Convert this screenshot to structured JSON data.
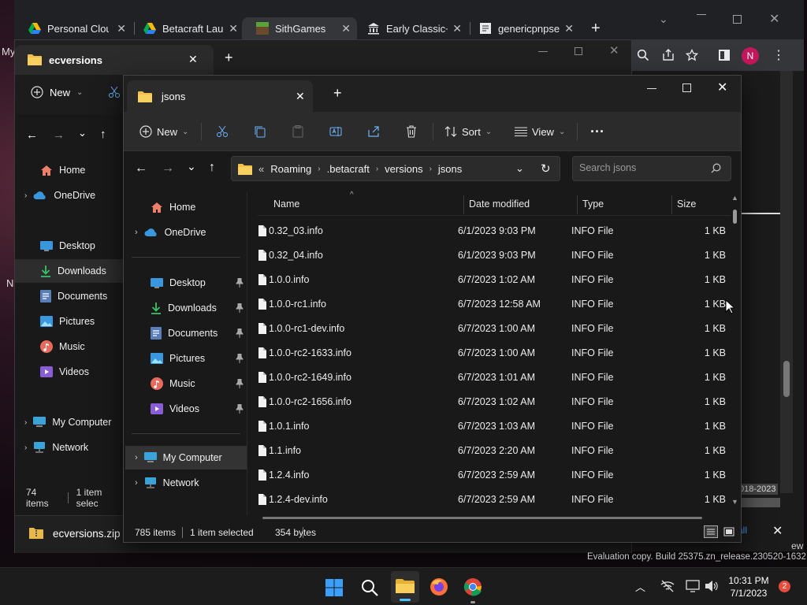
{
  "chrome": {
    "tabs": [
      {
        "title": "Personal Cloud",
        "icon": "drive-icon"
      },
      {
        "title": "Betacraft Launcher",
        "icon": "drive-icon"
      },
      {
        "title": "SithGames",
        "icon": "minecraft-icon"
      },
      {
        "title": "Early Classic+",
        "icon": "archive-icon"
      },
      {
        "title": "genericpnpservices",
        "icon": "page-icon"
      }
    ],
    "profile_initial": "N",
    "page_snippets": {
      "bottom_text": "018-2023",
      "side_text_my": "My",
      "side_text_n": "N",
      "side_text_ew": "ew",
      "link_all": "all"
    }
  },
  "back_explorer": {
    "tab_title": "ecversions",
    "new_label": "New",
    "sidebar": [
      {
        "label": "Home",
        "icon": "home-icon"
      },
      {
        "label": "OneDrive",
        "icon": "onedrive-icon"
      },
      {
        "label": "Desktop",
        "icon": "desktop-icon"
      },
      {
        "label": "Downloads",
        "icon": "downloads-icon"
      },
      {
        "label": "Documents",
        "icon": "documents-icon"
      },
      {
        "label": "Pictures",
        "icon": "pictures-icon"
      },
      {
        "label": "Music",
        "icon": "music-icon"
      },
      {
        "label": "Videos",
        "icon": "videos-icon"
      },
      {
        "label": "My Computer",
        "icon": "computer-icon"
      },
      {
        "label": "Network",
        "icon": "network-icon"
      }
    ],
    "status_items": "74 items",
    "status_selected": "1 item selec",
    "download_file": "ecversions.zip"
  },
  "front_explorer": {
    "tab_title": "jsons",
    "command_bar": {
      "new": "New",
      "sort": "Sort",
      "view": "View"
    },
    "address": {
      "prefix": "«",
      "crumbs": [
        "Roaming",
        ".betacraft",
        "versions",
        "jsons"
      ]
    },
    "search_placeholder": "Search jsons",
    "sidebar": [
      {
        "label": "Home",
        "icon": "home-icon"
      },
      {
        "label": "OneDrive",
        "icon": "onedrive-icon"
      },
      {
        "label": "Desktop",
        "icon": "desktop-icon"
      },
      {
        "label": "Downloads",
        "icon": "downloads-icon"
      },
      {
        "label": "Documents",
        "icon": "documents-icon"
      },
      {
        "label": "Pictures",
        "icon": "pictures-icon"
      },
      {
        "label": "Music",
        "icon": "music-icon"
      },
      {
        "label": "Videos",
        "icon": "videos-icon"
      },
      {
        "label": "My Computer",
        "icon": "computer-icon"
      },
      {
        "label": "Network",
        "icon": "network-icon"
      }
    ],
    "columns": [
      "Name",
      "Date modified",
      "Type",
      "Size"
    ],
    "files": [
      {
        "name": "0.32_03.info",
        "date": "6/1/2023 9:03 PM",
        "type": "INFO File",
        "size": "1 KB"
      },
      {
        "name": "0.32_04.info",
        "date": "6/1/2023 9:03 PM",
        "type": "INFO File",
        "size": "1 KB"
      },
      {
        "name": "1.0.0.info",
        "date": "6/7/2023 1:02 AM",
        "type": "INFO File",
        "size": "1 KB"
      },
      {
        "name": "1.0.0-rc1.info",
        "date": "6/7/2023 12:58 AM",
        "type": "INFO File",
        "size": "1 KB"
      },
      {
        "name": "1.0.0-rc1-dev.info",
        "date": "6/7/2023 1:00 AM",
        "type": "INFO File",
        "size": "1 KB"
      },
      {
        "name": "1.0.0-rc2-1633.info",
        "date": "6/7/2023 1:00 AM",
        "type": "INFO File",
        "size": "1 KB"
      },
      {
        "name": "1.0.0-rc2-1649.info",
        "date": "6/7/2023 1:01 AM",
        "type": "INFO File",
        "size": "1 KB"
      },
      {
        "name": "1.0.0-rc2-1656.info",
        "date": "6/7/2023 1:02 AM",
        "type": "INFO File",
        "size": "1 KB"
      },
      {
        "name": "1.0.1.info",
        "date": "6/7/2023 1:03 AM",
        "type": "INFO File",
        "size": "1 KB"
      },
      {
        "name": "1.1.info",
        "date": "6/7/2023 2:20 AM",
        "type": "INFO File",
        "size": "1 KB"
      },
      {
        "name": "1.2.4.info",
        "date": "6/7/2023 2:59 AM",
        "type": "INFO File",
        "size": "1 KB"
      },
      {
        "name": "1.2.4-dev.info",
        "date": "6/7/2023 2:59 AM",
        "type": "INFO File",
        "size": "1 KB"
      }
    ],
    "status": {
      "items": "785 items",
      "selected": "1 item selected",
      "size": "354 bytes"
    }
  },
  "watermark": "Evaluation copy. Build 25375.zn_release.230520-1632",
  "taskbar": {
    "time": "10:31 PM",
    "date": "7/1/2023",
    "notifications": "2"
  },
  "colors": {
    "accent": "#0078d4",
    "folder": "#f0c04a",
    "chrome_bg": "#202124",
    "explorer_bg": "#191919"
  }
}
